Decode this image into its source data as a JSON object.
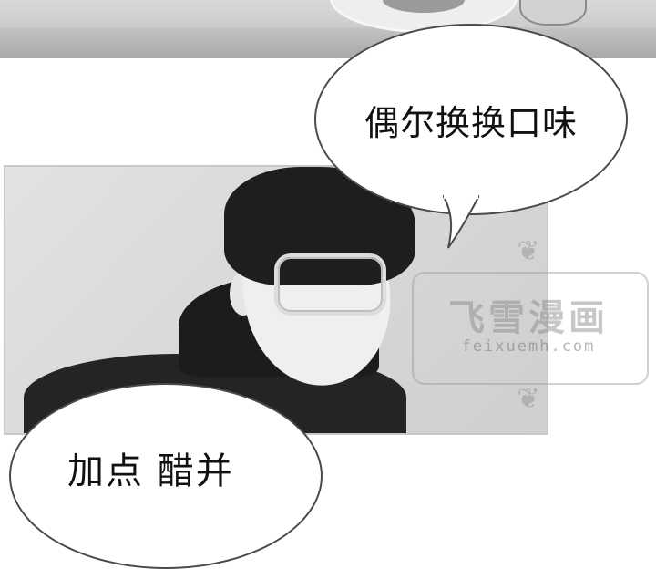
{
  "speech_bubbles": [
    {
      "text": "偶尔换换口味"
    },
    {
      "text": "加点 醋并"
    }
  ],
  "watermark": {
    "title": "飞雪漫画",
    "url": "feixuemh.com",
    "ornament_icon": "flourish-icon"
  },
  "colors": {
    "ink": "#111111",
    "bubble_fill": "#ffffff",
    "bubble_stroke": "#4a4a4a"
  }
}
